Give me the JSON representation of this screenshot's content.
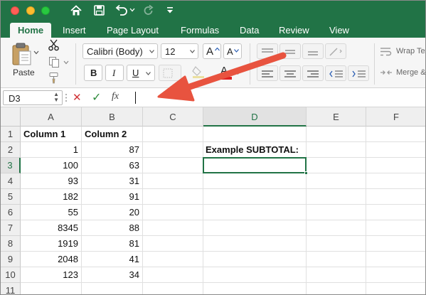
{
  "titlebar": {
    "icons": [
      "home-icon",
      "save-icon",
      "undo-icon",
      "redo-icon",
      "customize-toolbar-icon"
    ]
  },
  "tabs": [
    "Home",
    "Insert",
    "Page Layout",
    "Formulas",
    "Data",
    "Review",
    "View"
  ],
  "ribbon": {
    "paste_label": "Paste",
    "font_name": "Calibri (Body)",
    "font_size": "12",
    "bold_label": "B",
    "italic_label": "I",
    "underline_label": "U",
    "increase_font_label": "A",
    "decrease_font_label": "A",
    "font_color_label": "A",
    "wrap_text_label": "Wrap Tex",
    "merge_label": "Merge &",
    "font_color_swatch": "#e02020"
  },
  "formula_bar": {
    "name_box": "D3",
    "cancel_glyph": "✕",
    "enter_glyph": "✓",
    "fx_label": "fx",
    "formula_value": ""
  },
  "sheet": {
    "columns": [
      "A",
      "B",
      "C",
      "D",
      "E",
      "F"
    ],
    "rows": [
      "1",
      "2",
      "3",
      "4",
      "5",
      "6",
      "7",
      "8",
      "9",
      "10",
      "11"
    ],
    "headers": {
      "a1": "Column 1",
      "b1": "Column 2"
    },
    "col1_values": [
      "1",
      "100",
      "93",
      "182",
      "55",
      "8345",
      "1919",
      "2048",
      "123"
    ],
    "col2_values": [
      "87",
      "63",
      "31",
      "91",
      "20",
      "88",
      "81",
      "41",
      "34"
    ],
    "d2_label": "Example SUBTOTAL:",
    "active_cell": "D3"
  },
  "colors": {
    "excel_green": "#217346",
    "annotation_arrow": "#e8533f"
  }
}
